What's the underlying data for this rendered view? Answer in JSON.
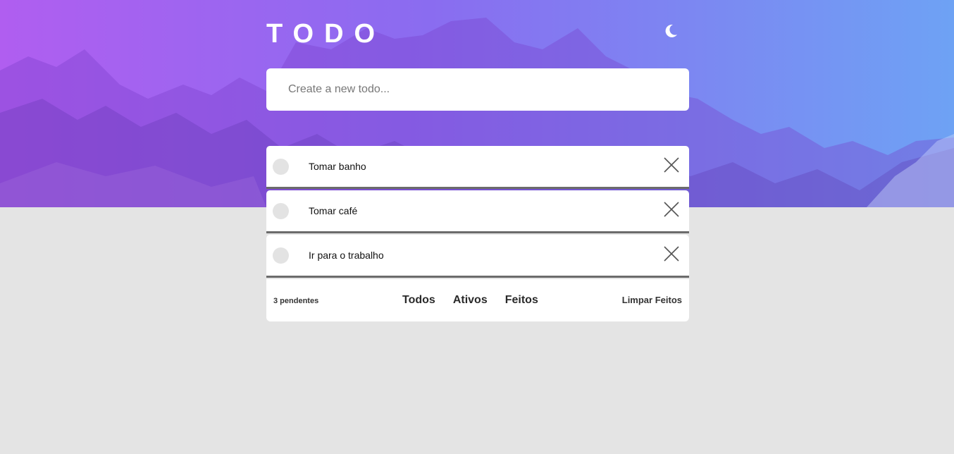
{
  "header": {
    "title": "TODO",
    "theme_icon": "moon-icon"
  },
  "new_todo": {
    "placeholder": "Create a new todo...",
    "value": ""
  },
  "todos": [
    {
      "text": "Tomar banho",
      "done": false
    },
    {
      "text": "Tomar café",
      "done": false
    },
    {
      "text": "Ir para o trabalho",
      "done": false
    }
  ],
  "footer": {
    "pending": "3 pendentes",
    "filters": [
      "Todos",
      "Ativos",
      "Feitos"
    ],
    "clear": "Limpar Feitos"
  },
  "colors": {
    "background": "#e4e4e4",
    "gradient_start": "#b05ef0",
    "gradient_end": "#6ea2f4",
    "card": "#ffffff",
    "item_border": "#6b6b6b"
  }
}
